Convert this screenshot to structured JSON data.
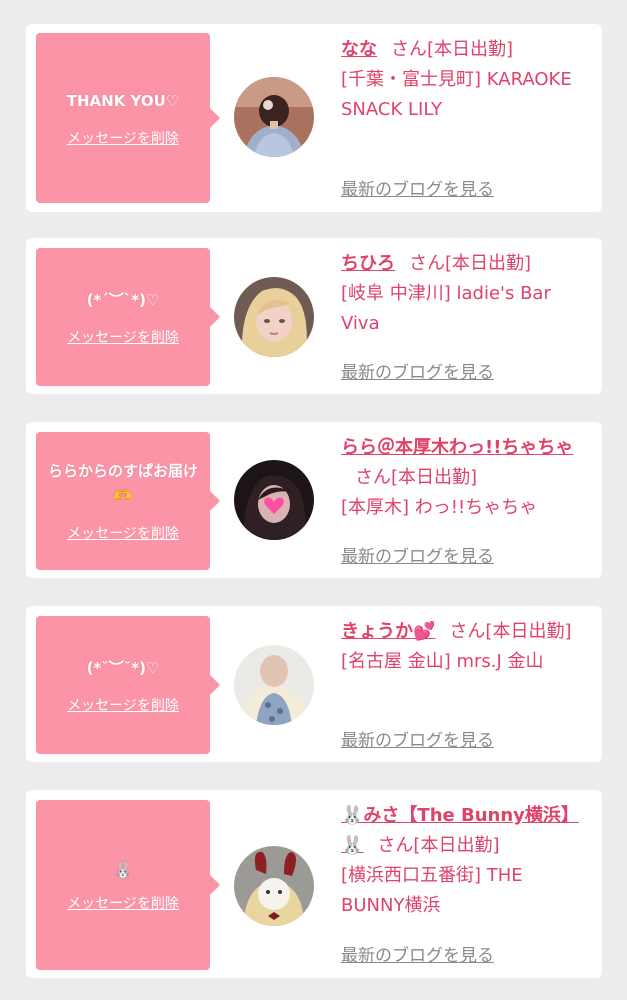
{
  "delete_label": "メッセージを削除",
  "blog_label": "最新のブログを見る",
  "san_label": "さん",
  "accent_color": "#fc94a8",
  "text_color": "#e0436a",
  "cards": [
    {
      "message": "THANK YOU♡",
      "name": "なな",
      "status": "[本日出勤]",
      "shop": "[千葉・富士見町] KARAOKE SNACK LILY",
      "avatar_icon": "woman-hair-updo-photo"
    },
    {
      "message": "(*´︶`*)♡",
      "name": "ちひろ",
      "status": "[本日出勤]",
      "shop": "[岐阜 中津川] ladie's Bar Viva",
      "avatar_icon": "blonde-woman-photo"
    },
    {
      "message": "ららからのすぱお届け🫶",
      "name": "らら＠本厚木わっ!!ちゃちゃ",
      "status": "[本日出勤]",
      "shop": "[本厚木] わっ!!ちゃちゃ",
      "avatar_icon": "dark-hair-heart-sticker-photo"
    },
    {
      "message": "(*˘︶˘*)♡",
      "name": "きょうか💕",
      "status": "[本日出勤]",
      "shop": "[名古屋 金山] mrs.J 金山",
      "avatar_icon": "woman-cardigan-photo"
    },
    {
      "message": "🐰",
      "name": "🐰みさ【The Bunny横浜】🐰",
      "status": "[本日出勤]",
      "shop": "[横浜西口五番街] THE BUNNY横浜",
      "avatar_icon": "bunny-ears-woman-photo"
    }
  ]
}
